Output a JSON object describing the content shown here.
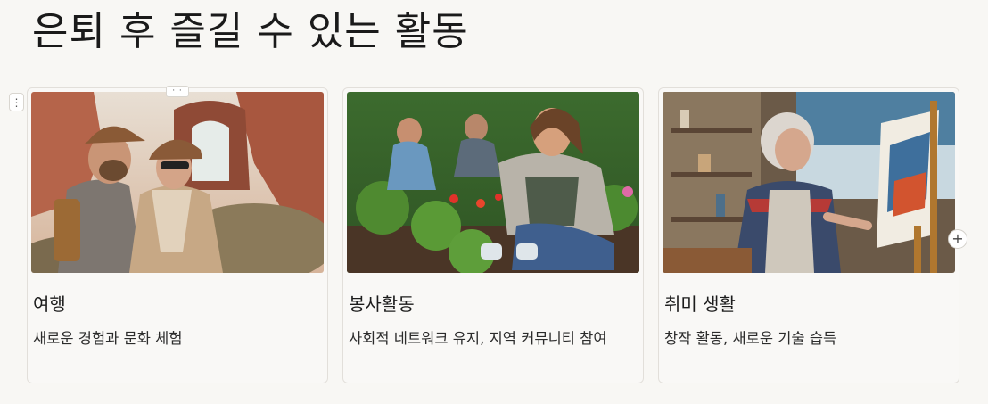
{
  "page": {
    "title": "은퇴 후 즐길 수 있는 활동"
  },
  "controls": {
    "block_handle": "⋮",
    "more_tab": "···",
    "add_button": "+"
  },
  "cards": [
    {
      "title": "여행",
      "description": "새로운 경험과 문화 체험",
      "image": "travel-couple-photo"
    },
    {
      "title": "봉사활동",
      "description": "사회적 네트워크 유지, 지역 커뮤니티 참여",
      "image": "volunteer-gardening-photo"
    },
    {
      "title": "취미 생활",
      "description": "창작 활동, 새로운 기술 습득",
      "image": "elderly-painting-photo"
    }
  ],
  "colors": {
    "background": "#f8f7f4",
    "card_border": "#e2dfda",
    "title_text": "#1a1a1a"
  }
}
